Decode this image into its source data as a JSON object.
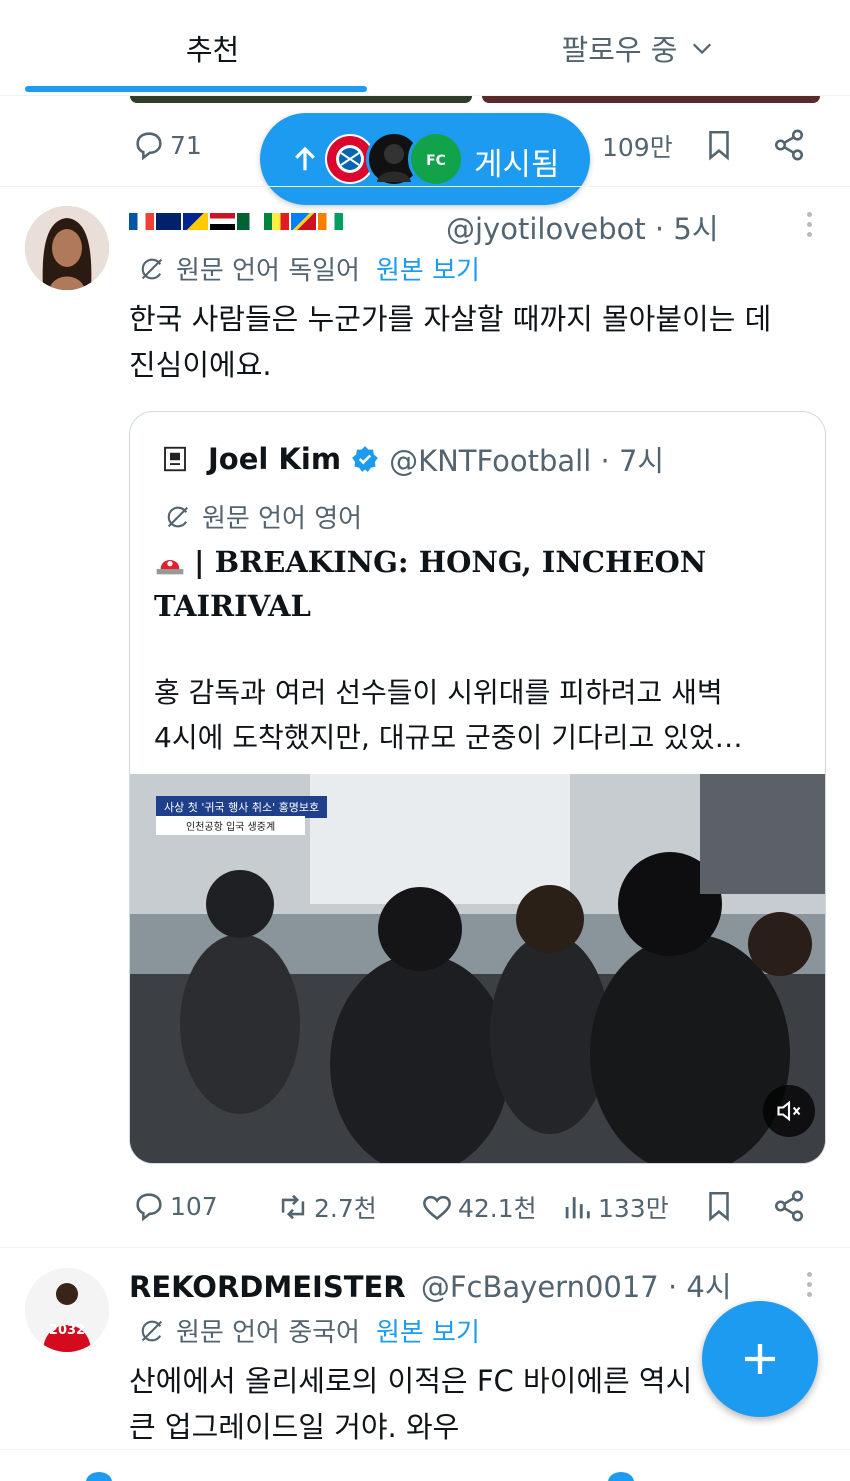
{
  "tabs": {
    "recommended": "추천",
    "following": "팔로우 중"
  },
  "colors": {
    "accent": "#1d9bf0",
    "secondary_text": "#536471",
    "primary_text": "#0f1419"
  },
  "prev_tweet": {
    "replies": "71",
    "views": "109만"
  },
  "posted_pill": {
    "label": "게시됨",
    "icons": [
      "arrow-up-icon",
      "fc-bayern-avatar",
      "masked-user-avatar",
      "spain-fc-avatar"
    ]
  },
  "tweet1": {
    "handle_time": "@jyotilovebot · 5시",
    "translation": {
      "label": "원문 언어 독일어",
      "link": "원본 보기"
    },
    "text_line1": "한국 사람들은 누군가를 자살할 때까지 몰아붙이는 데",
    "text_line2": "진심이에요.",
    "quote": {
      "name": "Joel Kim",
      "handle_time": "@KNTFootball · 7시",
      "translation_label": "원문 언어 영어",
      "title_line1": "| BREAKING: HONG, INCHEON",
      "title_line2": "TAIRIVAL",
      "text_line1": "홍 감독과 여러 선수들이 시위대를 피하려고 새벽",
      "text_line2": "4시에 도착했지만, 대규모 군중이 기다리고 있었…",
      "media_caption1": "사상 첫 '귀국 행사 취소' 홍명보호",
      "media_caption2": "인천공항 입국 생중계"
    },
    "actions": {
      "replies": "107",
      "reposts": "2.7천",
      "likes": "42.1천",
      "views": "133만"
    }
  },
  "tweet2": {
    "name": "REKORDMEISTER",
    "handle_time": "@FcBayern0017 · 4시",
    "translation": {
      "label": "원문 언어 중국어",
      "link": "원본 보기"
    },
    "text_line1": "산에에서 올리세로의 이적은 FC 바이에른 역시",
    "text_line2": "큰 업그레이드일 거야. 와우"
  }
}
